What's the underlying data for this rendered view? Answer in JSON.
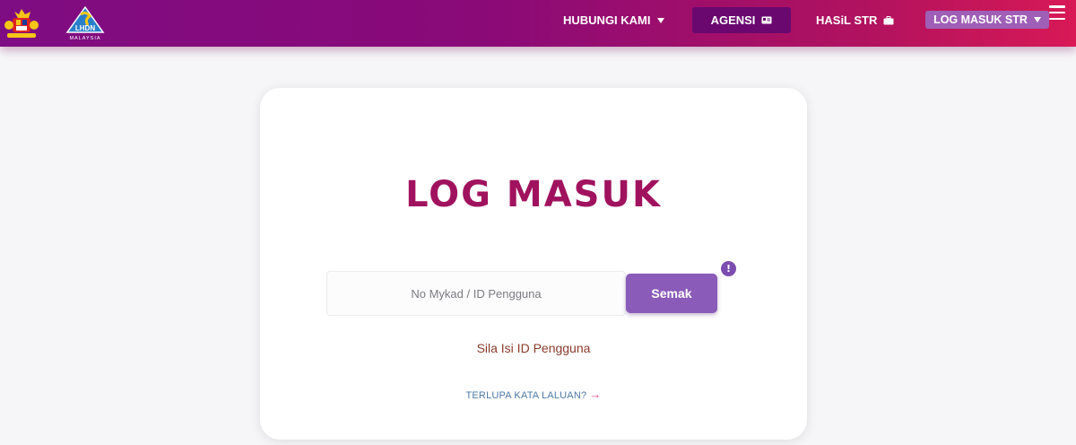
{
  "header": {
    "crest_logo": "malaysia-coat-of-arms-icon",
    "lhdn_logo": {
      "text": "LHDN",
      "subtext": "MALAYSIA"
    },
    "nav": {
      "contact_label": "HUBUNGI KAMI",
      "agency_label": "AGENSI",
      "result_label": "HASiL STR",
      "login_label": "LOG MASUK STR"
    },
    "menu_icon": "hamburger-menu-icon"
  },
  "login": {
    "title": "LOG MASUK",
    "id_placeholder": "No Mykad / ID Pengguna",
    "id_value": "",
    "check_label": "Semak",
    "info_badge": "!",
    "helper": "Sila Isi ID Pengguna",
    "forgot_label": "TERLUPA KATA LALUAN?",
    "forgot_arrow": "→"
  },
  "colors": {
    "header_start": "#7e0c82",
    "header_end": "#d81956",
    "title": "#a0125e",
    "button": "#8a5bb8"
  }
}
